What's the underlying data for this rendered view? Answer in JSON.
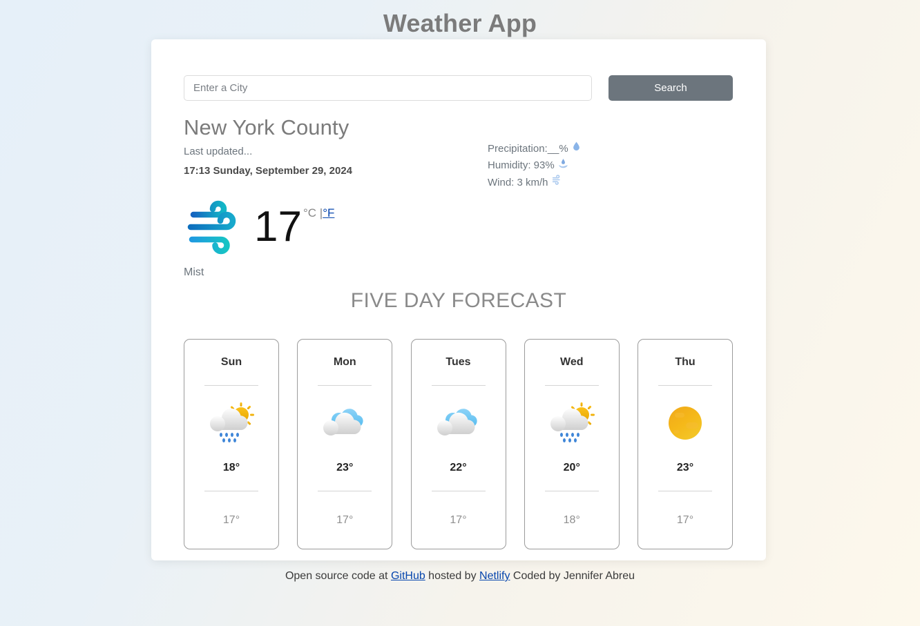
{
  "header": {
    "title": "Weather App"
  },
  "search": {
    "placeholder": "Enter a City",
    "value": "",
    "button_label": "Search"
  },
  "current": {
    "city": "New York County",
    "updated_label": "Last updated...",
    "updated_time": "17:13 Sunday, September 29, 2024",
    "temperature": "17",
    "unit_celsius": "°C",
    "unit_separator": "|",
    "unit_fahrenheit": "°F",
    "condition": "Mist",
    "icon": "mist-wind-icon",
    "details": [
      {
        "label": "Precipitation:__%",
        "icon": "water-drop-icon"
      },
      {
        "label": "Humidity: 93%",
        "icon": "humidity-hand-icon"
      },
      {
        "label": "Wind: 3 km/h",
        "icon": "wind-icon"
      }
    ]
  },
  "forecast": {
    "title": "FIVE DAY FORECAST",
    "days": [
      {
        "day": "Sun",
        "icon": "sun-behind-rain-cloud-icon",
        "high": "18°",
        "low": "17°"
      },
      {
        "day": "Mon",
        "icon": "cloudy-icon",
        "high": "23°",
        "low": "17°"
      },
      {
        "day": "Tues",
        "icon": "cloudy-icon",
        "high": "22°",
        "low": "17°"
      },
      {
        "day": "Wed",
        "icon": "sun-behind-rain-cloud-icon",
        "high": "20°",
        "low": "18°"
      },
      {
        "day": "Thu",
        "icon": "sun-icon",
        "high": "23°",
        "low": "17°"
      }
    ]
  },
  "footer": {
    "text_start": "Open source code at ",
    "link_github": "GitHub",
    "text_middle": " hosted by ",
    "link_netlify": "Netlify",
    "text_end": " Coded by Jennifer Abreu"
  },
  "colors": {
    "accent_button": "#6c757d",
    "link": "#0645ad",
    "title_gray": "#7b7b7b",
    "bg_left": "#e6f0f9",
    "bg_right": "#fdf8ec"
  }
}
